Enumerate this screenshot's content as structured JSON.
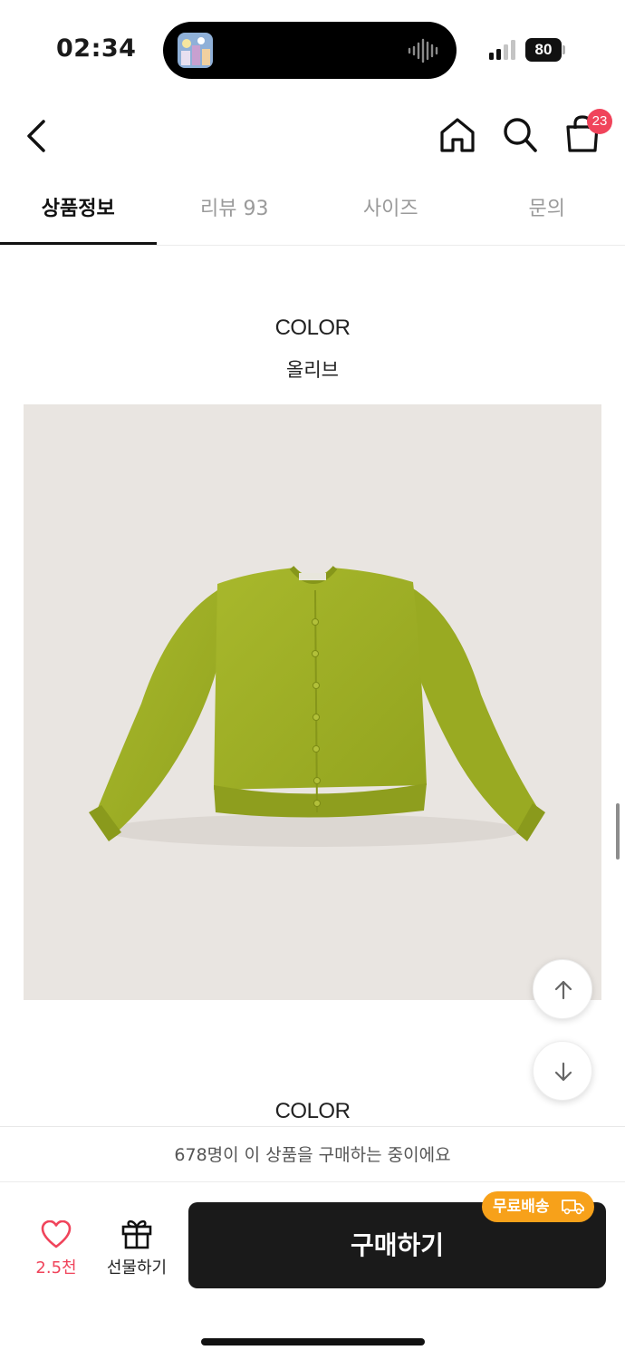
{
  "status_bar": {
    "time": "02:34",
    "battery": "80"
  },
  "header": {
    "back_icon": "chevron-left-icon",
    "home_icon": "home-icon",
    "search_icon": "search-icon",
    "cart_icon": "shopping-bag-icon",
    "cart_count": "23",
    "badge_color": "#f0445b"
  },
  "tabs": [
    {
      "label": "상품정보",
      "active": true
    },
    {
      "label": "리뷰 93",
      "active": false
    },
    {
      "label": "사이즈",
      "active": false
    },
    {
      "label": "문의",
      "active": false
    }
  ],
  "content": {
    "sections": [
      {
        "title": "COLOR",
        "color_name": "올리브"
      },
      {
        "title": "COLOR"
      }
    ],
    "product_image": "olive-green-cardigan",
    "scroll_up_icon": "arrow-up-icon",
    "scroll_down_icon": "arrow-down-icon"
  },
  "notice": {
    "text": "678명이 이 상품을 구매하는 중이에요"
  },
  "bottom_bar": {
    "like_count": "2.5천",
    "gift_label": "선물하기",
    "buy_label": "구매하기",
    "shipping_badge": "무료배송",
    "accent_color": "#f7a11a",
    "buy_color": "#1a1a1a"
  }
}
